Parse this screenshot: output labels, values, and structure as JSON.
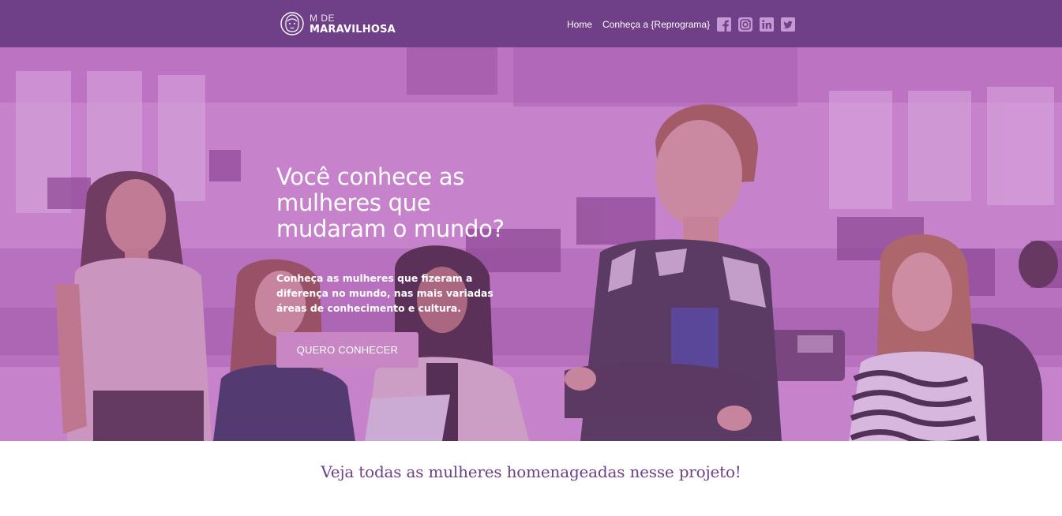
{
  "brand": {
    "logo_icon": "woman-face-icon",
    "small_text": "M DE",
    "big_text": "MARAVILHOSA"
  },
  "nav": {
    "items": [
      {
        "label": "Home"
      },
      {
        "label": "Conheça a {Reprograma}"
      }
    ],
    "social": [
      {
        "icon": "facebook-icon"
      },
      {
        "icon": "instagram-icon"
      },
      {
        "icon": "linkedin-icon"
      },
      {
        "icon": "twitter-icon"
      }
    ]
  },
  "hero": {
    "title": "Você conhece as mulheres que mudaram o mundo?",
    "subtitle": "Conheça as mulheres que fizeram a diferença no mundo, nas mais variadas áreas de conhecimento e cultura.",
    "cta_label": "QUERO CONHECER"
  },
  "section": {
    "title": "Veja todas as mulheres homenageadas nesse projeto!"
  },
  "colors": {
    "header": "#6f3f87",
    "hero_overlay": "#c98fcf",
    "button": "#c887c4",
    "section_title": "#6f3f87"
  }
}
